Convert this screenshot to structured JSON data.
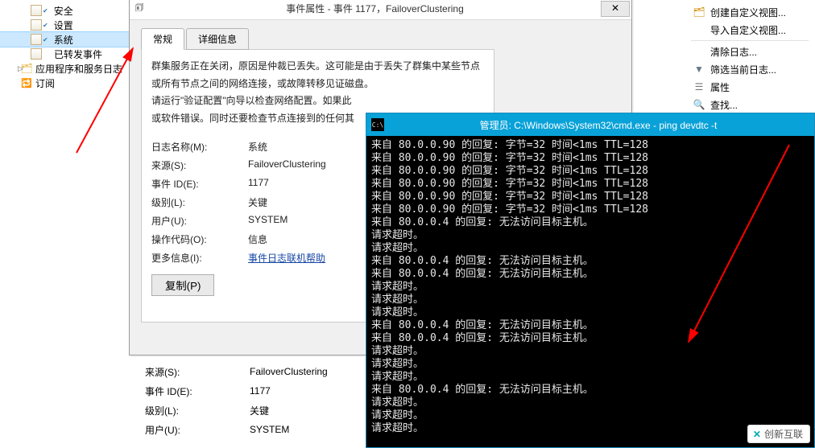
{
  "nav": {
    "items": [
      {
        "label": "安全",
        "sel": false
      },
      {
        "label": "设置",
        "sel": false
      },
      {
        "label": "系统",
        "sel": true
      },
      {
        "label": "已转发事件",
        "sel": false
      }
    ],
    "apps_label": "应用程序和服务日志",
    "subs_label": "订阅"
  },
  "actions": {
    "create_custom_view": "创建自定义视图...",
    "import_custom_view": "导入自定义视图...",
    "clear_log": "清除日志...",
    "filter_current": "筛选当前日志...",
    "properties": "属性",
    "find": "查找..."
  },
  "dialog": {
    "title": "事件属性 - 事件 1177，FailoverClustering",
    "tabs": {
      "general": "常规",
      "details": "详细信息"
    },
    "description_p1": "群集服务正在关闭，原因是仲裁已丢失。这可能是由于丢失了群集中某些节点或所有节点之间的网络连接，或故障转移见证磁盘。",
    "description_p2": "请运行\"验证配置\"向导以检查网络配置。如果此",
    "description_p3": "或软件错误。同时还要检查节点连接到的任何其",
    "fields": {
      "log_name_label": "日志名称(M):",
      "log_name_value": "系统",
      "source_label": "来源(S):",
      "source_value": "FailoverClustering",
      "event_id_label": "事件 ID(E):",
      "event_id_value": "1177",
      "level_label": "级别(L):",
      "level_value": "关键",
      "user_label": "用户(U):",
      "user_value": "SYSTEM",
      "opcode_label": "操作代码(O):",
      "opcode_value": "信息",
      "more_info_label": "更多信息(I):",
      "more_info_link": "事件日志联机帮助"
    },
    "copy_button": "复制(P)"
  },
  "behind": {
    "rows": [
      {
        "label": "来源(S):",
        "value": "FailoverClustering"
      },
      {
        "label": "事件 ID(E):",
        "value": "1177"
      },
      {
        "label": "级别(L):",
        "value": "关键"
      },
      {
        "label": "用户(U):",
        "value": "SYSTEM"
      }
    ]
  },
  "cmd": {
    "title": "管理员: C:\\Windows\\System32\\cmd.exe - ping  devdtc -t",
    "lines": [
      "来自 80.0.0.90 的回复: 字节=32 时间<1ms TTL=128",
      "来自 80.0.0.90 的回复: 字节=32 时间<1ms TTL=128",
      "来自 80.0.0.90 的回复: 字节=32 时间<1ms TTL=128",
      "来自 80.0.0.90 的回复: 字节=32 时间<1ms TTL=128",
      "来自 80.0.0.90 的回复: 字节=32 时间<1ms TTL=128",
      "来自 80.0.0.90 的回复: 字节=32 时间<1ms TTL=128",
      "来自 80.0.0.4 的回复: 无法访问目标主机。",
      "请求超时。",
      "请求超时。",
      "来自 80.0.0.4 的回复: 无法访问目标主机。",
      "来自 80.0.0.4 的回复: 无法访问目标主机。",
      "请求超时。",
      "请求超时。",
      "请求超时。",
      "来自 80.0.0.4 的回复: 无法访问目标主机。",
      "来自 80.0.0.4 的回复: 无法访问目标主机。",
      "请求超时。",
      "请求超时。",
      "请求超时。",
      "来自 80.0.0.4 的回复: 无法访问目标主机。",
      "请求超时。",
      "请求超时。",
      "请求超时。"
    ]
  },
  "watermark": "创新互联"
}
